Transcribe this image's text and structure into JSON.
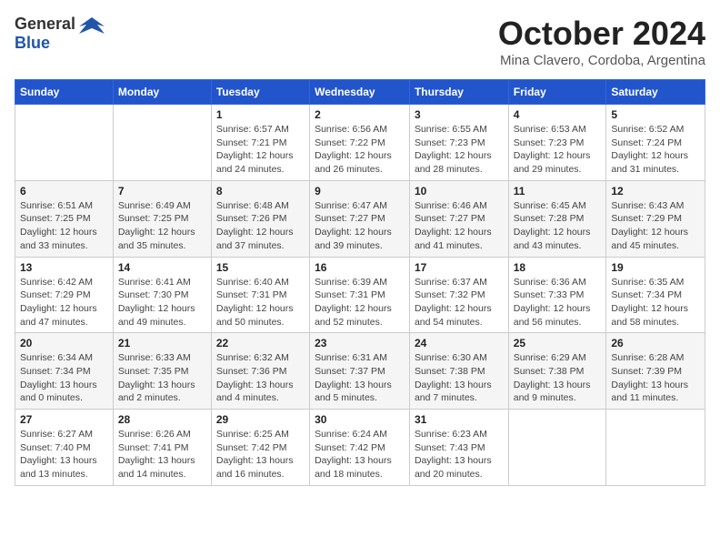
{
  "logo": {
    "general": "General",
    "blue": "Blue"
  },
  "title": "October 2024",
  "location": "Mina Clavero, Cordoba, Argentina",
  "days_header": [
    "Sunday",
    "Monday",
    "Tuesday",
    "Wednesday",
    "Thursday",
    "Friday",
    "Saturday"
  ],
  "weeks": [
    [
      {
        "day": "",
        "content": ""
      },
      {
        "day": "",
        "content": ""
      },
      {
        "day": "1",
        "content": "Sunrise: 6:57 AM\nSunset: 7:21 PM\nDaylight: 12 hours\nand 24 minutes."
      },
      {
        "day": "2",
        "content": "Sunrise: 6:56 AM\nSunset: 7:22 PM\nDaylight: 12 hours\nand 26 minutes."
      },
      {
        "day": "3",
        "content": "Sunrise: 6:55 AM\nSunset: 7:23 PM\nDaylight: 12 hours\nand 28 minutes."
      },
      {
        "day": "4",
        "content": "Sunrise: 6:53 AM\nSunset: 7:23 PM\nDaylight: 12 hours\nand 29 minutes."
      },
      {
        "day": "5",
        "content": "Sunrise: 6:52 AM\nSunset: 7:24 PM\nDaylight: 12 hours\nand 31 minutes."
      }
    ],
    [
      {
        "day": "6",
        "content": "Sunrise: 6:51 AM\nSunset: 7:25 PM\nDaylight: 12 hours\nand 33 minutes."
      },
      {
        "day": "7",
        "content": "Sunrise: 6:49 AM\nSunset: 7:25 PM\nDaylight: 12 hours\nand 35 minutes."
      },
      {
        "day": "8",
        "content": "Sunrise: 6:48 AM\nSunset: 7:26 PM\nDaylight: 12 hours\nand 37 minutes."
      },
      {
        "day": "9",
        "content": "Sunrise: 6:47 AM\nSunset: 7:27 PM\nDaylight: 12 hours\nand 39 minutes."
      },
      {
        "day": "10",
        "content": "Sunrise: 6:46 AM\nSunset: 7:27 PM\nDaylight: 12 hours\nand 41 minutes."
      },
      {
        "day": "11",
        "content": "Sunrise: 6:45 AM\nSunset: 7:28 PM\nDaylight: 12 hours\nand 43 minutes."
      },
      {
        "day": "12",
        "content": "Sunrise: 6:43 AM\nSunset: 7:29 PM\nDaylight: 12 hours\nand 45 minutes."
      }
    ],
    [
      {
        "day": "13",
        "content": "Sunrise: 6:42 AM\nSunset: 7:29 PM\nDaylight: 12 hours\nand 47 minutes."
      },
      {
        "day": "14",
        "content": "Sunrise: 6:41 AM\nSunset: 7:30 PM\nDaylight: 12 hours\nand 49 minutes."
      },
      {
        "day": "15",
        "content": "Sunrise: 6:40 AM\nSunset: 7:31 PM\nDaylight: 12 hours\nand 50 minutes."
      },
      {
        "day": "16",
        "content": "Sunrise: 6:39 AM\nSunset: 7:31 PM\nDaylight: 12 hours\nand 52 minutes."
      },
      {
        "day": "17",
        "content": "Sunrise: 6:37 AM\nSunset: 7:32 PM\nDaylight: 12 hours\nand 54 minutes."
      },
      {
        "day": "18",
        "content": "Sunrise: 6:36 AM\nSunset: 7:33 PM\nDaylight: 12 hours\nand 56 minutes."
      },
      {
        "day": "19",
        "content": "Sunrise: 6:35 AM\nSunset: 7:34 PM\nDaylight: 12 hours\nand 58 minutes."
      }
    ],
    [
      {
        "day": "20",
        "content": "Sunrise: 6:34 AM\nSunset: 7:34 PM\nDaylight: 13 hours\nand 0 minutes."
      },
      {
        "day": "21",
        "content": "Sunrise: 6:33 AM\nSunset: 7:35 PM\nDaylight: 13 hours\nand 2 minutes."
      },
      {
        "day": "22",
        "content": "Sunrise: 6:32 AM\nSunset: 7:36 PM\nDaylight: 13 hours\nand 4 minutes."
      },
      {
        "day": "23",
        "content": "Sunrise: 6:31 AM\nSunset: 7:37 PM\nDaylight: 13 hours\nand 5 minutes."
      },
      {
        "day": "24",
        "content": "Sunrise: 6:30 AM\nSunset: 7:38 PM\nDaylight: 13 hours\nand 7 minutes."
      },
      {
        "day": "25",
        "content": "Sunrise: 6:29 AM\nSunset: 7:38 PM\nDaylight: 13 hours\nand 9 minutes."
      },
      {
        "day": "26",
        "content": "Sunrise: 6:28 AM\nSunset: 7:39 PM\nDaylight: 13 hours\nand 11 minutes."
      }
    ],
    [
      {
        "day": "27",
        "content": "Sunrise: 6:27 AM\nSunset: 7:40 PM\nDaylight: 13 hours\nand 13 minutes."
      },
      {
        "day": "28",
        "content": "Sunrise: 6:26 AM\nSunset: 7:41 PM\nDaylight: 13 hours\nand 14 minutes."
      },
      {
        "day": "29",
        "content": "Sunrise: 6:25 AM\nSunset: 7:42 PM\nDaylight: 13 hours\nand 16 minutes."
      },
      {
        "day": "30",
        "content": "Sunrise: 6:24 AM\nSunset: 7:42 PM\nDaylight: 13 hours\nand 18 minutes."
      },
      {
        "day": "31",
        "content": "Sunrise: 6:23 AM\nSunset: 7:43 PM\nDaylight: 13 hours\nand 20 minutes."
      },
      {
        "day": "",
        "content": ""
      },
      {
        "day": "",
        "content": ""
      }
    ]
  ]
}
